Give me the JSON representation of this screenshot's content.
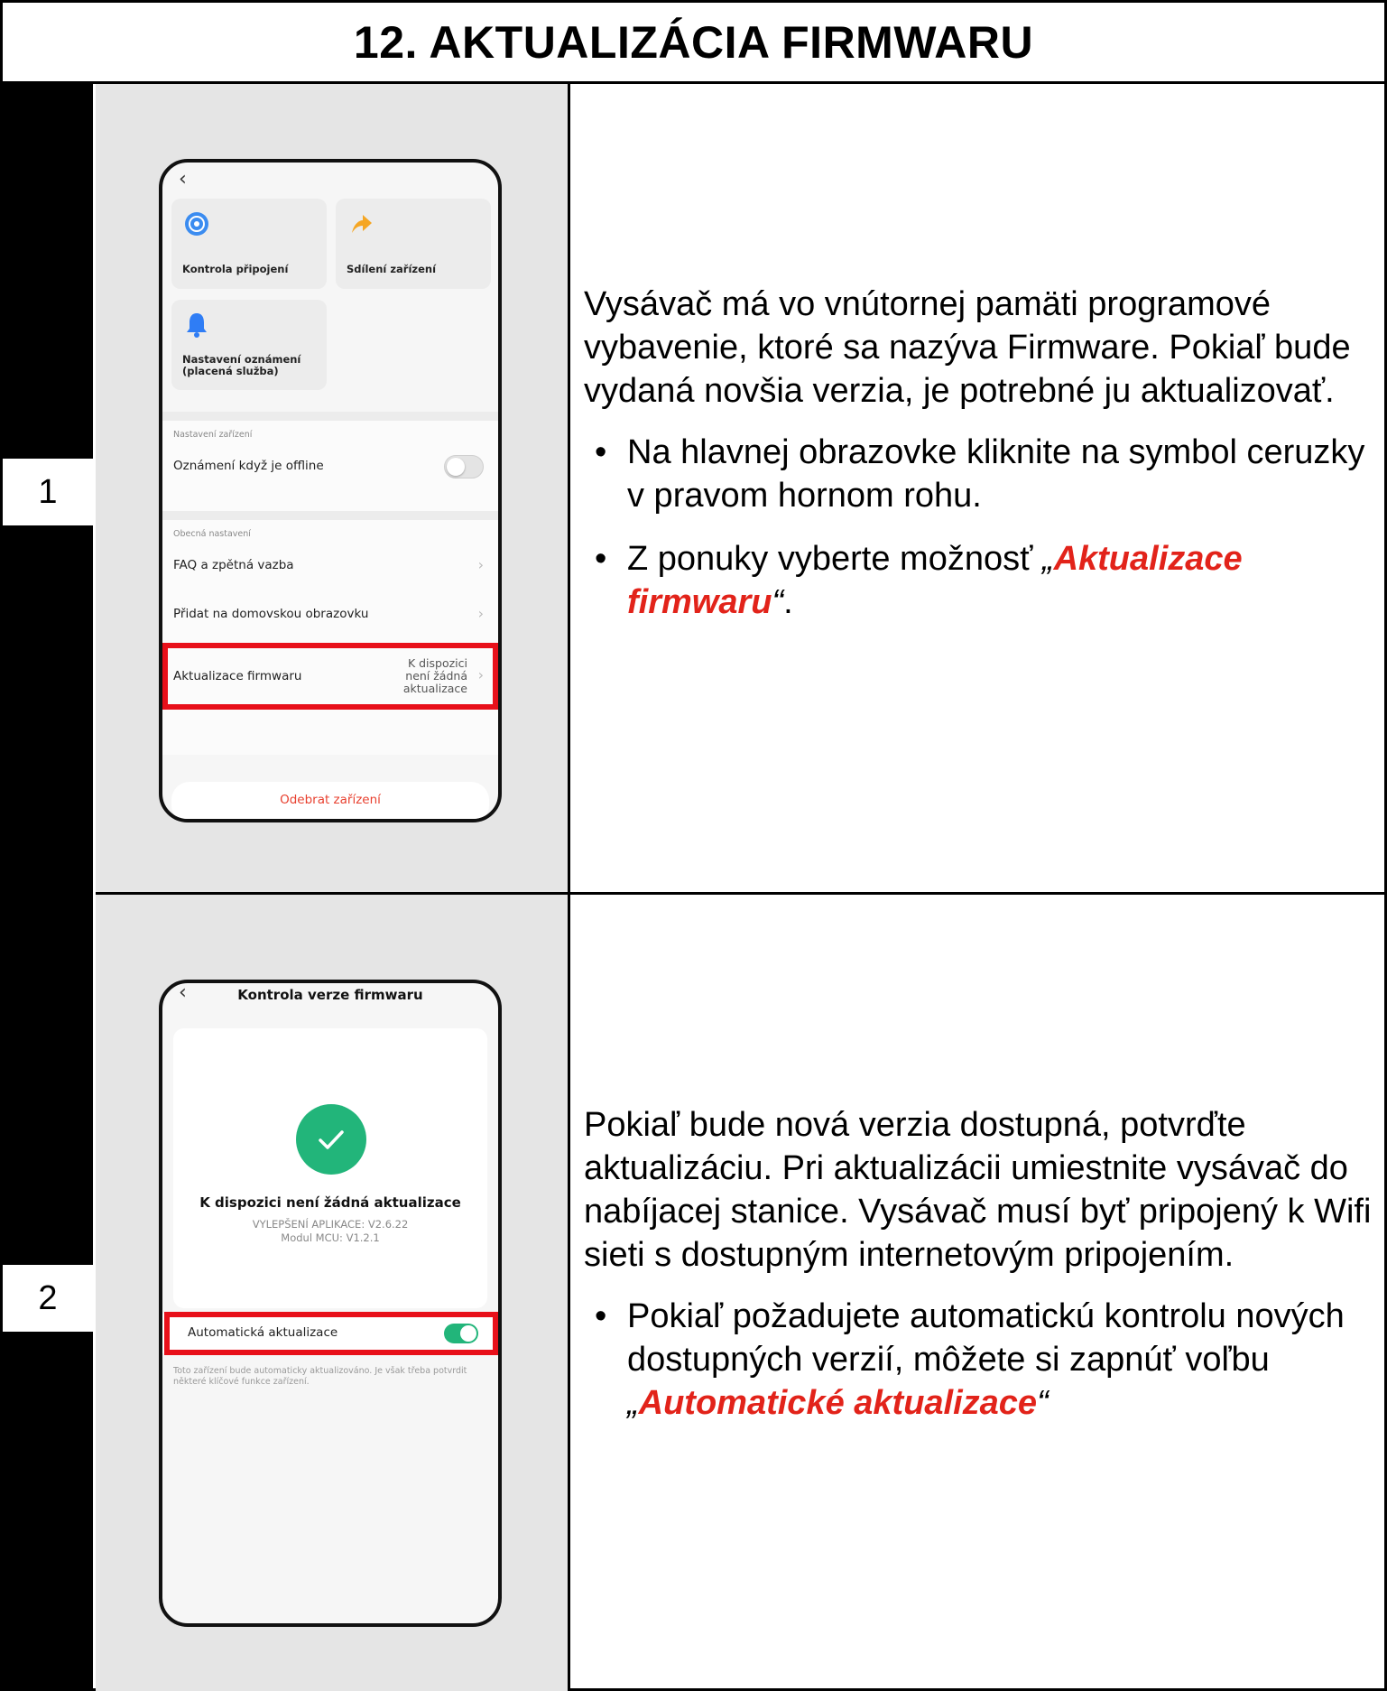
{
  "title": "12. AKTUALIZÁCIA FIRMWARU",
  "steps": [
    {
      "number": "1",
      "phone": {
        "tiles": [
          "Kontrola připojení",
          "Sdílení zařízení",
          "Nastavení oznámení",
          "(placená služba)"
        ],
        "section_device": "Nastavení zařízení",
        "offline_label": "Oznámení když je offline",
        "section_general": "Obecná nastavení",
        "faq": "FAQ a zpětná vazba",
        "add_home": "Přidat na domovskou obrazovku",
        "firmware_label": "Aktualizace firmwaru",
        "firmware_status": [
          "K dispozici",
          "není žádná",
          "aktualizace"
        ],
        "remove": "Odebrat zařízení"
      },
      "text": {
        "intro": "Vysávač má vo vnútornej pamäti programové vybavenie, ktoré sa nazýva Firmware. Pokiaľ bude vydaná novšia verzia, je potrebné ju aktualizovať.",
        "bullet1": "Na hlavnej obrazovke kliknite na symbol ceruzky v pravom hornom rohu.",
        "bullet2_pre": "Z ponuky vyberte možnosť ",
        "open_quote": "„",
        "bullet2_hl": "Aktualizace firmwaru",
        "close_quote": "“",
        "bullet2_post": "."
      }
    },
    {
      "number": "2",
      "phone": {
        "header": "Kontrola verze firmwaru",
        "status": "K dispozici není žádná aktualizace",
        "app_version": "VYLEPŠENÍ APLIKACE: V2.6.22",
        "mcu_version": "Modul MCU: V1.2.1",
        "auto_label": "Automatická aktualizace",
        "auto_on": true,
        "note": "Toto zařízení bude automaticky aktualizováno. Je však třeba potvrdit některé klíčové funkce zařízení."
      },
      "text": {
        "intro": "Pokiaľ bude nová verzia dostupná, potvrďte aktualizáciu. Pri aktualizácii umiestnite vysávač  do nabíjacej stanice. Vysávač musí byť pripojený k Wifi sieti s dostupným internetovým pripojením.",
        "bullet1_pre": "Pokiaľ požadujete automatickú kontrolu nových dostupných verzií, môžete si zapnúť voľbu ",
        "open_quote": "„",
        "bullet1_hl": "Automatické aktualizace",
        "close_quote": "“"
      }
    }
  ],
  "colors": {
    "highlight": "#e2231a",
    "success": "#22b57a",
    "frame_red": "#e8101a"
  }
}
